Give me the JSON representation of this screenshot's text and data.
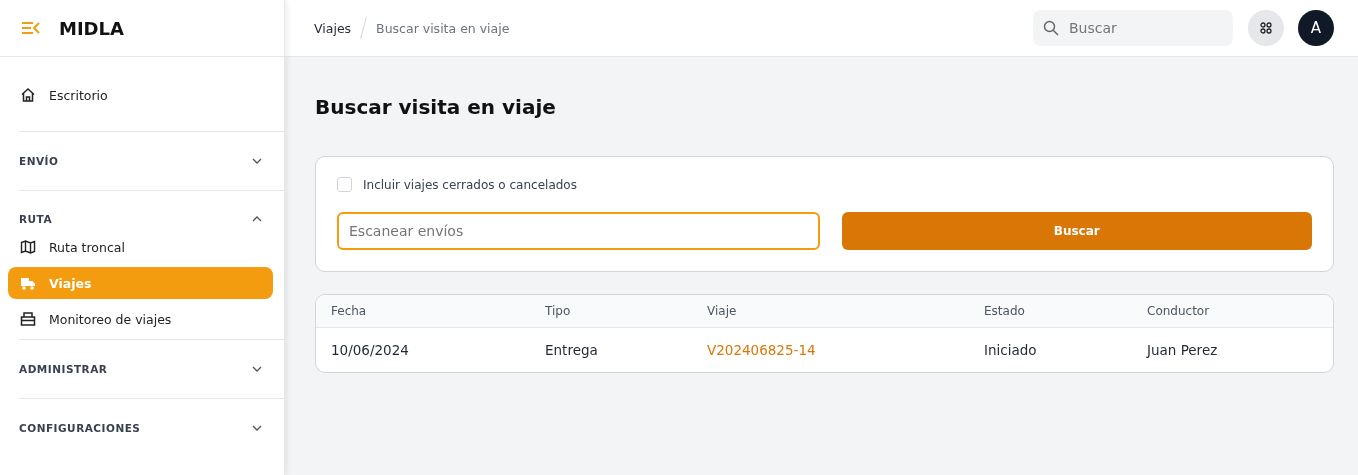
{
  "brand": {
    "name": "MIDLA"
  },
  "sidebar": {
    "items": [
      {
        "label": "Escritorio",
        "selected": false
      }
    ],
    "groups": [
      {
        "label": "ENVÍO",
        "expanded": false
      },
      {
        "label": "RUTA",
        "expanded": true,
        "items": [
          {
            "label": "Ruta troncal",
            "selected": false
          },
          {
            "label": "Viajes",
            "selected": true
          },
          {
            "label": "Monitoreo de viajes",
            "selected": false
          }
        ]
      },
      {
        "label": "ADMINISTRAR",
        "expanded": false
      },
      {
        "label": "CONFIGURACIONES",
        "expanded": false
      }
    ]
  },
  "breadcrumb": [
    "Viajes",
    "Buscar visita en viaje"
  ],
  "search": {
    "placeholder": "Buscar"
  },
  "avatar": {
    "initial": "A"
  },
  "page": {
    "title": "Buscar visita en viaje"
  },
  "filters": {
    "include_closed": {
      "label": "Incluir viajes cerrados o cancelados",
      "checked": false
    },
    "scan": {
      "placeholder": "Escanear envíos"
    },
    "button": "Buscar"
  },
  "table": {
    "columns": [
      "Fecha",
      "Tipo",
      "Viaje",
      "Estado",
      "Conductor"
    ],
    "rows": [
      {
        "cells": [
          "10/06/2024",
          "Entrega",
          "V202406825-14",
          "Iniciado",
          "Juan Perez"
        ]
      }
    ]
  }
}
